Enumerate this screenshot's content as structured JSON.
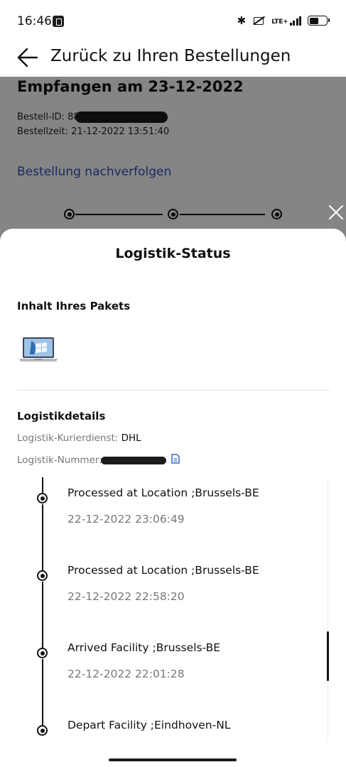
{
  "status_bar": {
    "time": "16:46",
    "lte_label": "LTE+",
    "icons": [
      "app-notification-icon",
      "bluetooth-icon",
      "silent-icon",
      "signal-icon",
      "battery-icon"
    ]
  },
  "header": {
    "back_label": "Zurück zu Ihren Bestellungen"
  },
  "order": {
    "title": "Empfangen am 23-12-2022",
    "id_label": "Bestell-ID: ",
    "id_value_visible": "88",
    "time_label": "Bestellzeit: ",
    "time_value": "21-12-2022 13:51:40",
    "track_link": "Bestellung nachverfolgen"
  },
  "sheet": {
    "title": "Logistik-Status",
    "package_heading": "Inhalt Ihres Pakets",
    "logistics_heading": "Logistikdetails",
    "courier_label": "Logistik-Kurierdienst: ",
    "courier_value": "DHL",
    "number_label": "Logistik-Nummer: "
  },
  "timeline": [
    {
      "status": "Processed at Location ;Brussels-BE",
      "time": "22-12-2022 23:06:49"
    },
    {
      "status": "Processed at Location ;Brussels-BE",
      "time": "22-12-2022 22:58:20"
    },
    {
      "status": "Arrived Facility ;Brussels-BE",
      "time": "22-12-2022 22:01:28"
    },
    {
      "status": "Depart Facility ;Eindhoven-NL",
      "time": ""
    }
  ],
  "colors": {
    "link": "#2d4fb5",
    "overlay": "rgba(0,0,0,0.48)",
    "muted_text": "#777777"
  }
}
